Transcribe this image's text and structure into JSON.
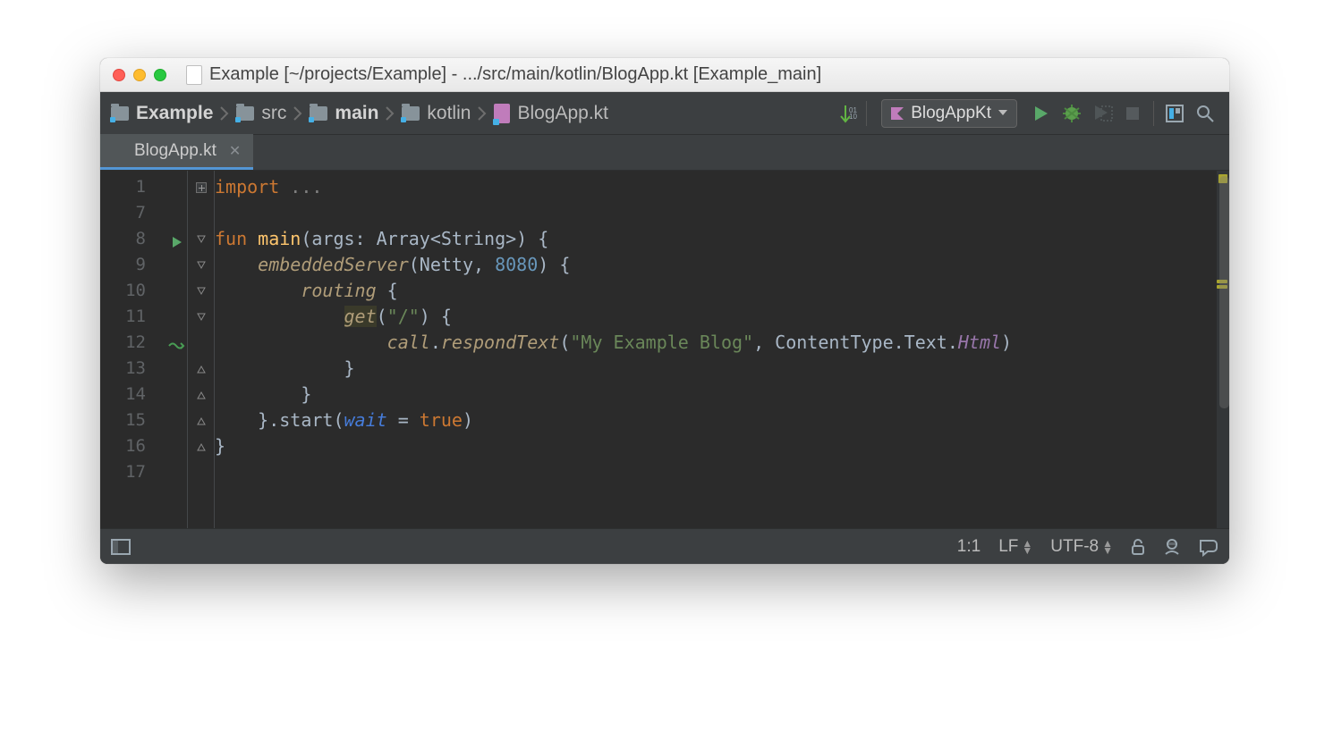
{
  "title": "Example [~/projects/Example] - .../src/main/kotlin/BlogApp.kt [Example_main]",
  "breadcrumbs": [
    {
      "label": "Example",
      "bold": true
    },
    {
      "label": "src",
      "bold": false
    },
    {
      "label": "main",
      "bold": true
    },
    {
      "label": "kotlin",
      "bold": false
    },
    {
      "label": "BlogApp.kt",
      "bold": false,
      "file": true
    }
  ],
  "runConfig": "BlogAppKt",
  "tab": {
    "label": "BlogApp.kt"
  },
  "gutter_lines": [
    "1",
    "7",
    "8",
    "9",
    "10",
    "11",
    "12",
    "13",
    "14",
    "15",
    "16",
    "17"
  ],
  "code": {
    "l1": {
      "kw": "import",
      "rest": " ..."
    },
    "l8": {
      "kw": "fun",
      "fn": "main",
      "sig": "(args: Array<String>) {"
    },
    "l9": {
      "call": "embeddedServer",
      "open": "(Netty, ",
      "num": "8080",
      "close": ") {"
    },
    "l10": {
      "call": "routing",
      "rest": " {"
    },
    "l11": {
      "call": "get",
      "open": "(",
      "str": "\"/\"",
      "close": ") {"
    },
    "l12": {
      "recv": "call",
      "dot": ".",
      "call": "respondText",
      "open": "(",
      "str": "\"My Example Blog\"",
      "mid": ", ContentType.Text.",
      "mem": "Html",
      "close": ")"
    },
    "l13": "}",
    "l14": "}",
    "l15": {
      "pre": "}.start(",
      "na": "wait",
      "eq": " = ",
      "kw": "true",
      "post": ")"
    },
    "l16": "}"
  },
  "status": {
    "pos": "1:1",
    "eol": "LF",
    "enc": "UTF-8"
  }
}
